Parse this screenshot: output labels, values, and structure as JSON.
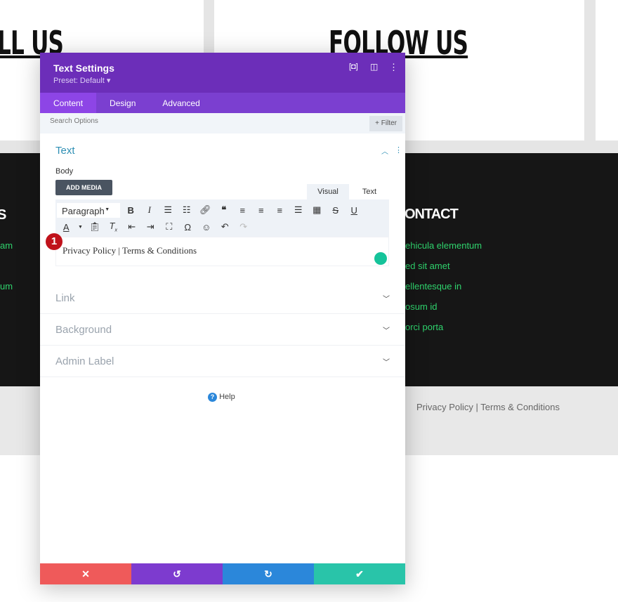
{
  "page": {
    "heading_left": "LL US",
    "heading_right": "FOLLOW US",
    "contact_heading": "ONTACT",
    "left_heading": "S",
    "contact_items": [
      "ehicula elementum",
      "ed sit amet",
      "ellentesque in",
      "osum id",
      "orci porta"
    ],
    "left_items": [
      "am",
      "um"
    ],
    "footer_text": "Privacy Policy | Terms & Conditions"
  },
  "modal": {
    "title": "Text Settings",
    "preset": "Preset: Default ▾",
    "tabs": [
      {
        "label": "Content"
      },
      {
        "label": "Design"
      },
      {
        "label": "Advanced"
      }
    ],
    "search_placeholder": "Search Options",
    "filter_label": "+ Filter",
    "section_title": "Text",
    "body_label": "Body",
    "add_media": "ADD MEDIA",
    "editor_tabs": [
      "Visual",
      "Text"
    ],
    "format_select": "Paragraph",
    "editor_content": "Privacy Policy | Terms & Conditions",
    "badge": "1",
    "collapsed_sections": [
      "Link",
      "Background",
      "Admin Label"
    ],
    "help": "Help"
  },
  "colors": {
    "header": "#6c2eb9",
    "tabs": "#7b3fd0",
    "cancel": "#ef5a5a",
    "undo": "#7d3bcf",
    "redo": "#2b87da",
    "save": "#29c4a9",
    "link_green": "#2fd36d"
  }
}
